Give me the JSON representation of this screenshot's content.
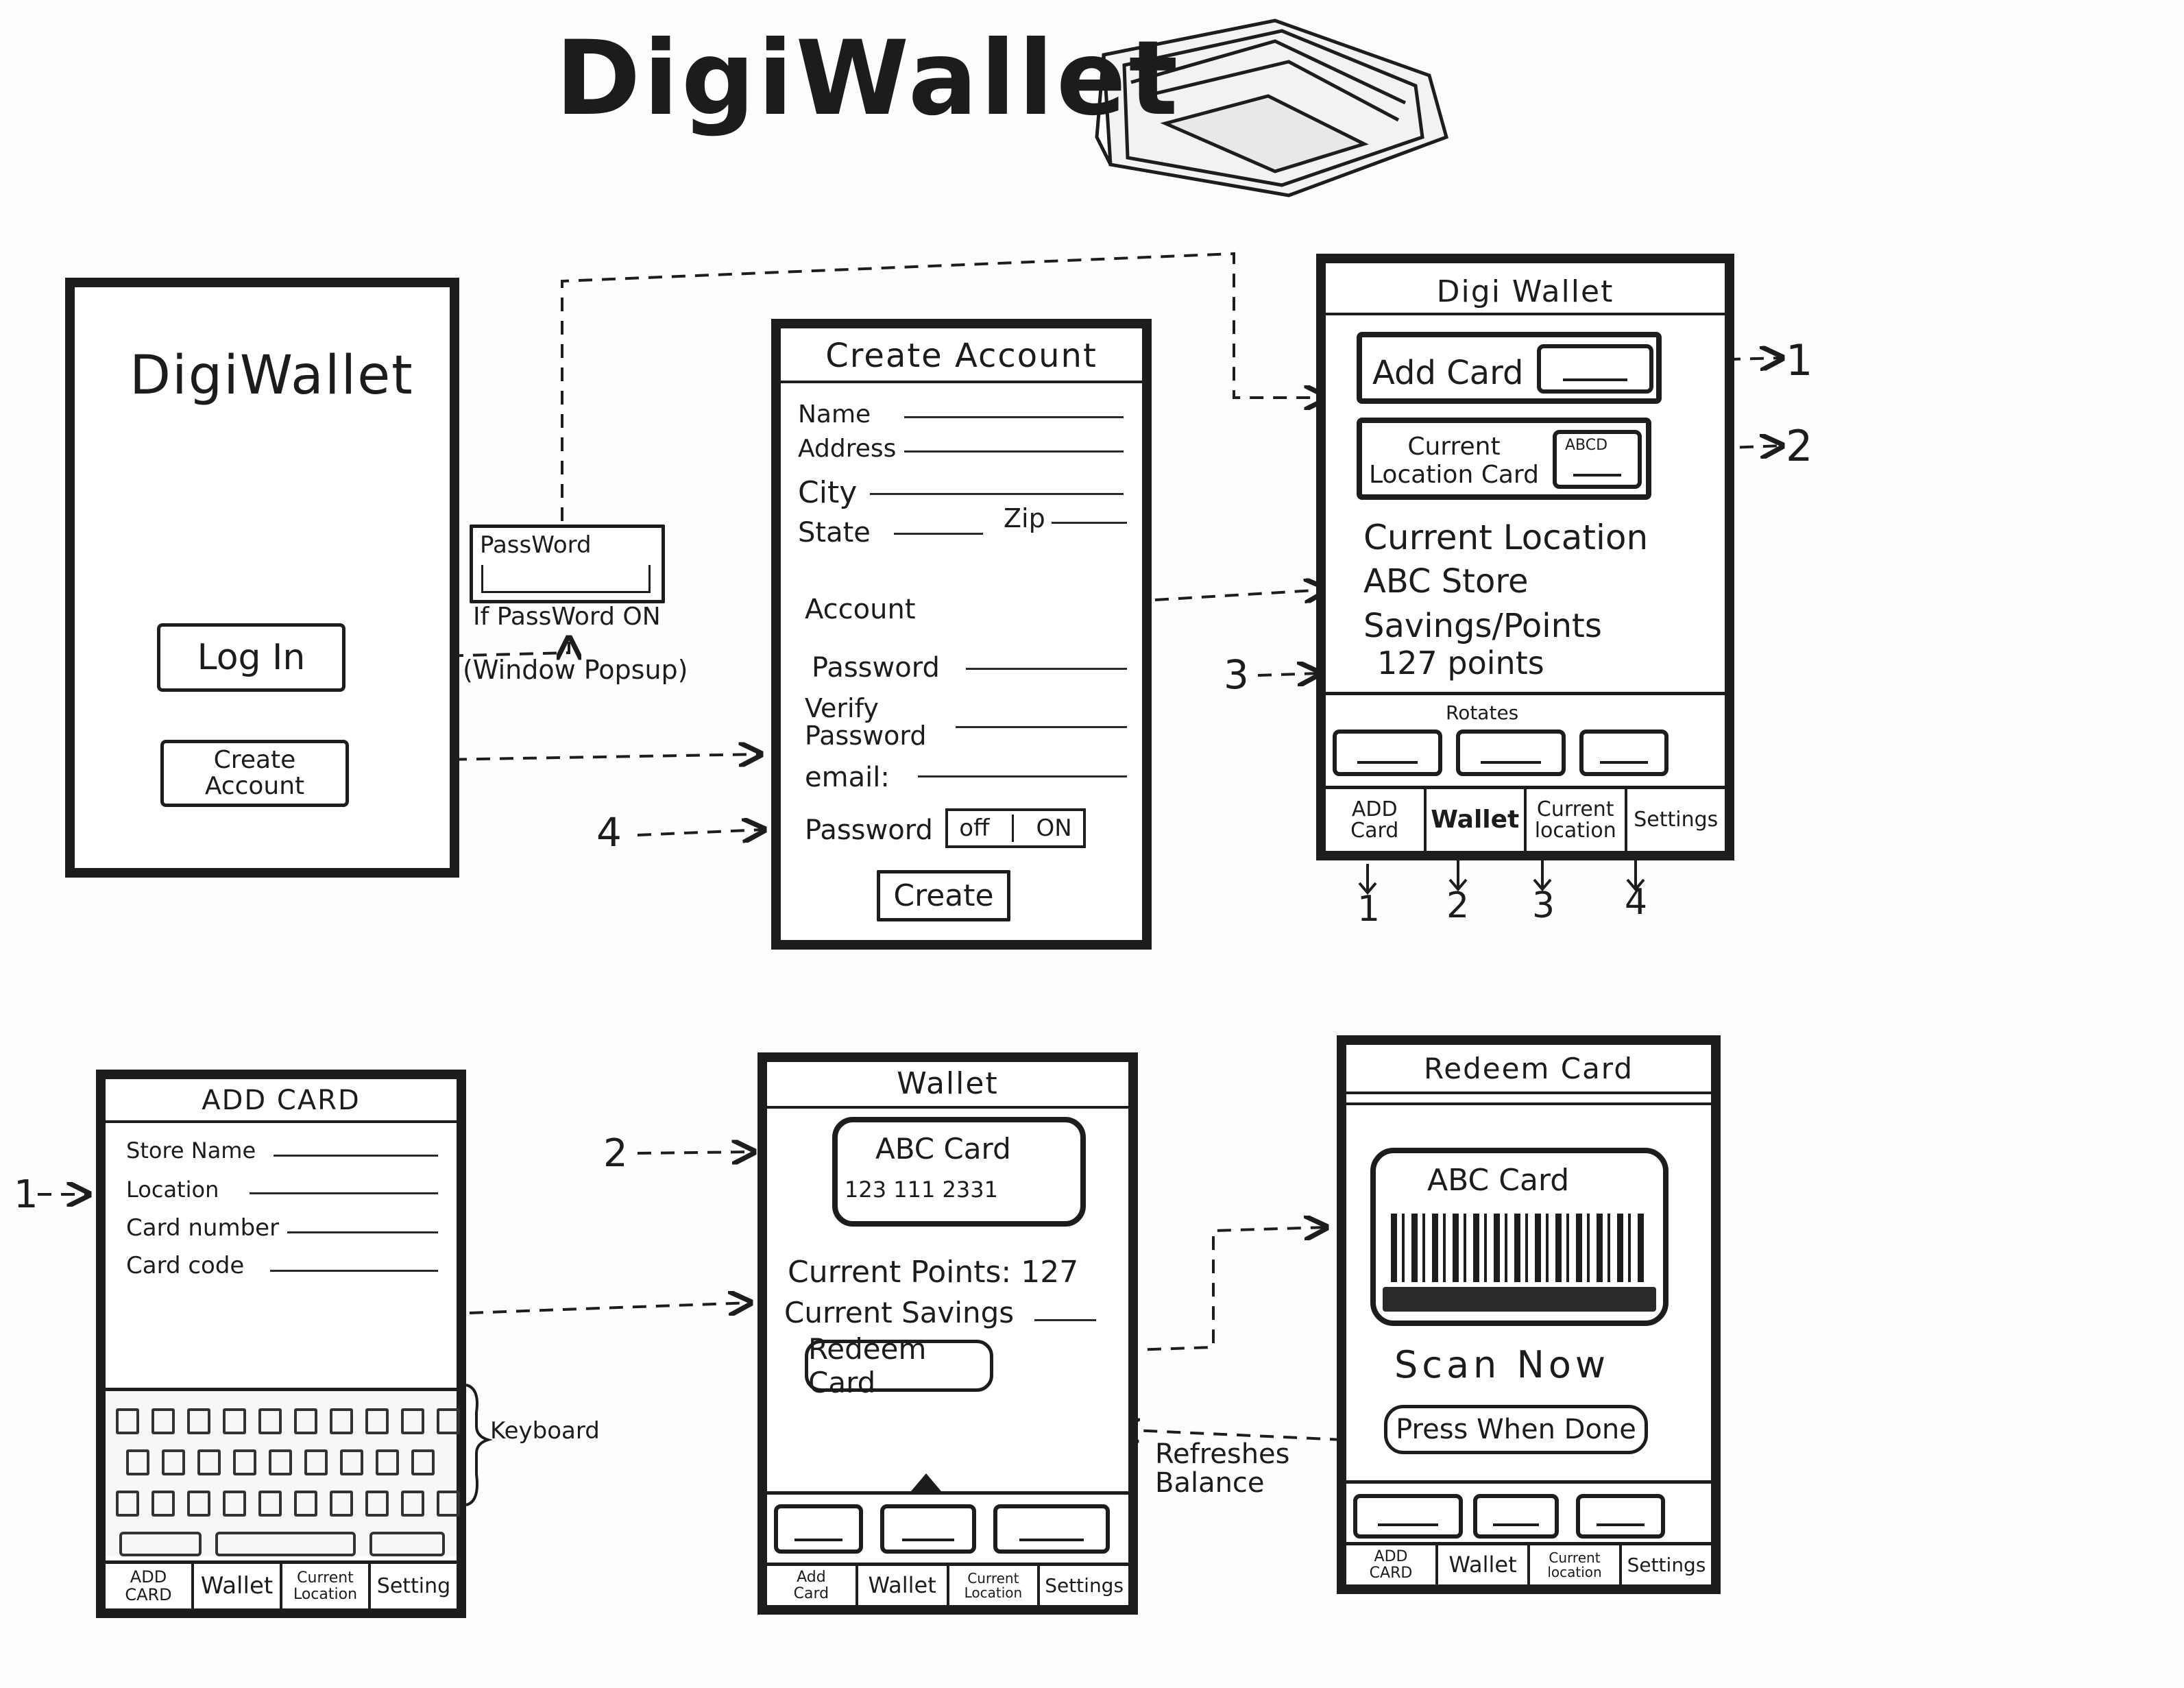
{
  "app_title": "DigiWallet",
  "screens": {
    "login": {
      "title": "DigiWallet",
      "login_button": "Log In",
      "create_account_button": "Create\nAccount"
    },
    "password_popup": {
      "label": "PassWord",
      "note_line1": "If PassWord ON",
      "note_line2": "(Window Popsup)"
    },
    "create_account": {
      "title": "Create Account",
      "fields": [
        "Name",
        "Address",
        "City",
        "State",
        "Zip"
      ],
      "account_heading": "Account",
      "account_fields": [
        "Password",
        "Verify\nPassword",
        "email:"
      ],
      "password_toggle_label": "Password",
      "toggle_off": "off",
      "toggle_on": "ON",
      "create_button": "Create"
    },
    "home": {
      "title": "Digi Wallet",
      "add_card": "Add Card",
      "current_location_card": "Current\nLocation Card",
      "card_thumb_label": "ABCD",
      "current_location_heading": "Current Location",
      "store": "ABC Store",
      "savings_points": "Savings/Points",
      "points": "127 points",
      "rotates": "Rotates",
      "tabs": [
        "ADD\nCard",
        "Wallet",
        "Current\nlocation",
        "Settings"
      ],
      "tab_numbers": [
        "1",
        "2",
        "3",
        "4"
      ]
    },
    "add_card": {
      "title": "ADD CARD",
      "fields": [
        "Store Name",
        "Location",
        "Card number",
        "Card code"
      ],
      "keyboard_label": "Keyboard",
      "tabs": [
        "ADD\nCARD",
        "Wallet",
        "Current\nLocation",
        "Setting"
      ]
    },
    "wallet": {
      "title": "Wallet",
      "card_name": "ABC Card",
      "card_number": "123  111  2331",
      "current_points": "Current Points: 127",
      "current_savings": "Current Savings",
      "redeem_button": "Redeem Card",
      "tabs": [
        "Add\nCard",
        "Wallet",
        "Current\nLocation",
        "Settings"
      ]
    },
    "redeem": {
      "title": "Redeem Card",
      "card_name": "ABC Card",
      "scan_now": "Scan Now",
      "press_when_done": "Press When Done",
      "tabs": [
        "ADD\nCARD",
        "Wallet",
        "Current\nlocation",
        "Settings"
      ]
    }
  },
  "annotations": {
    "arrow_1": "1",
    "arrow_2": "2",
    "arrow_3": "3",
    "arrow_4": "4",
    "refreshes_balance": "Refreshes\nBalance"
  }
}
